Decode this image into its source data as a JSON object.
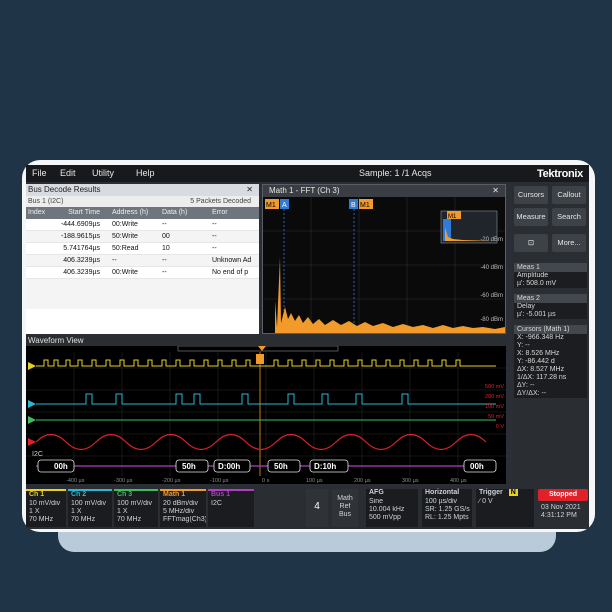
{
  "colors": {
    "background": "#1f3446",
    "ch1": "#e8d21f",
    "ch2": "#29b7d3",
    "ch3": "#3cbf5c",
    "math1": "#f29a2a",
    "bus": "#b03ec4",
    "stop": "#e0212a"
  },
  "menu": {
    "items": [
      "File",
      "Edit",
      "Utility",
      "Help"
    ],
    "status": "Sample: 1 /1 Acqs",
    "logo": "Tektronix"
  },
  "bus_decode": {
    "title": "Bus Decode Results",
    "bus_name": "Bus 1 (I2C)",
    "packets": "5 Packets Decoded",
    "columns": [
      "Index",
      "Start Time",
      "Address (h)",
      "Data (h)",
      "Error"
    ],
    "rows": [
      {
        "index": "",
        "time": "-444.6909µs",
        "addr": "00:Write",
        "data": "--",
        "error": "--"
      },
      {
        "index": "",
        "time": "-188.9615µs",
        "addr": "50:Write",
        "data": "00",
        "error": "--"
      },
      {
        "index": "",
        "time": "5.741764µs",
        "addr": "50:Read",
        "data": "10",
        "error": "--"
      },
      {
        "index": "",
        "time": "406.3239µs",
        "addr": "--",
        "data": "--",
        "error": "Unknown Ad"
      },
      {
        "index": "",
        "time": "406.3239µs",
        "addr": "00:Write",
        "data": "--",
        "error": "No end of p"
      }
    ]
  },
  "fft": {
    "title": "Math 1 - FFT (Ch 3)",
    "marker_m1": "M1",
    "marker_a": "A",
    "marker_b": "B",
    "y_labels": [
      "-20 dBm",
      "-40 dBm",
      "-60 dBm",
      "-80 dBm"
    ]
  },
  "waveform": {
    "title": "Waveform View",
    "right_labels": [
      "500 mV",
      "200 mV",
      "100 mV",
      "50 mV",
      "0 V"
    ],
    "bus_label": "I2C",
    "bus_values": [
      "00h",
      "50h",
      "D:00h",
      "50h",
      "D:10h",
      "00h"
    ],
    "time_ticks": [
      "-400 µs",
      "-300 µs",
      "-200 µs",
      "-100 µs",
      "0 s",
      "100 µs",
      "200 µs",
      "300 µs",
      "400 µs"
    ]
  },
  "sidebar": {
    "buttons": [
      "Cursors",
      "Callout",
      "Measure",
      "Search",
      "More..."
    ],
    "meas1": {
      "title": "Meas 1",
      "lines": [
        "Amplitude",
        "µ': 508.0 mV"
      ]
    },
    "meas2": {
      "title": "Meas 2",
      "lines": [
        "Delay",
        "µ': -5.001 µs"
      ]
    },
    "cursors": {
      "title": "Cursors (Math 1)",
      "lines": [
        "X: -966.348 Hz",
        "Y: --",
        "X: 8.526 MHz",
        "Y: -86.442 d",
        "ΔX: 8.527 MHz",
        "1/ΔX: 117.28 ns",
        "ΔY: --",
        "ΔY/ΔX: --"
      ]
    }
  },
  "badges": {
    "ch1": {
      "title": "Ch 1",
      "lines": [
        "10 mV/div",
        "1 X",
        "70 MHz"
      ]
    },
    "ch2": {
      "title": "Ch 2",
      "lines": [
        "100 mV/div",
        "1 X",
        "70 MHz"
      ]
    },
    "ch3": {
      "title": "Ch 3",
      "lines": [
        "100 mV/div",
        "1 X",
        "70 MHz"
      ]
    },
    "math1": {
      "title": "Math 1",
      "lines": [
        "20 dBm/div",
        "5 MHz/div",
        "FFTmag(Ch3)"
      ]
    },
    "bus1": {
      "title": "Bus 1",
      "lines": [
        "I2C"
      ]
    },
    "add_count": "4",
    "math_ref_bus": [
      "Math",
      "Ref",
      "Bus"
    ],
    "afg": {
      "title": "AFG",
      "lines": [
        "Sine",
        "10.004 kHz",
        "500 mVpp"
      ]
    },
    "horizontal": {
      "title": "Horizontal",
      "lines": [
        "100 µs/div",
        "SR: 1.25 GS/s",
        "RL: 1.25 Mpts"
      ]
    },
    "trigger": {
      "title": "Trigger",
      "mode": "N",
      "lines": [
        "∕ 0 V"
      ]
    },
    "acq": {
      "state": "Stopped",
      "date": "03 Nov 2021",
      "time": "4:31:12 PM"
    }
  }
}
